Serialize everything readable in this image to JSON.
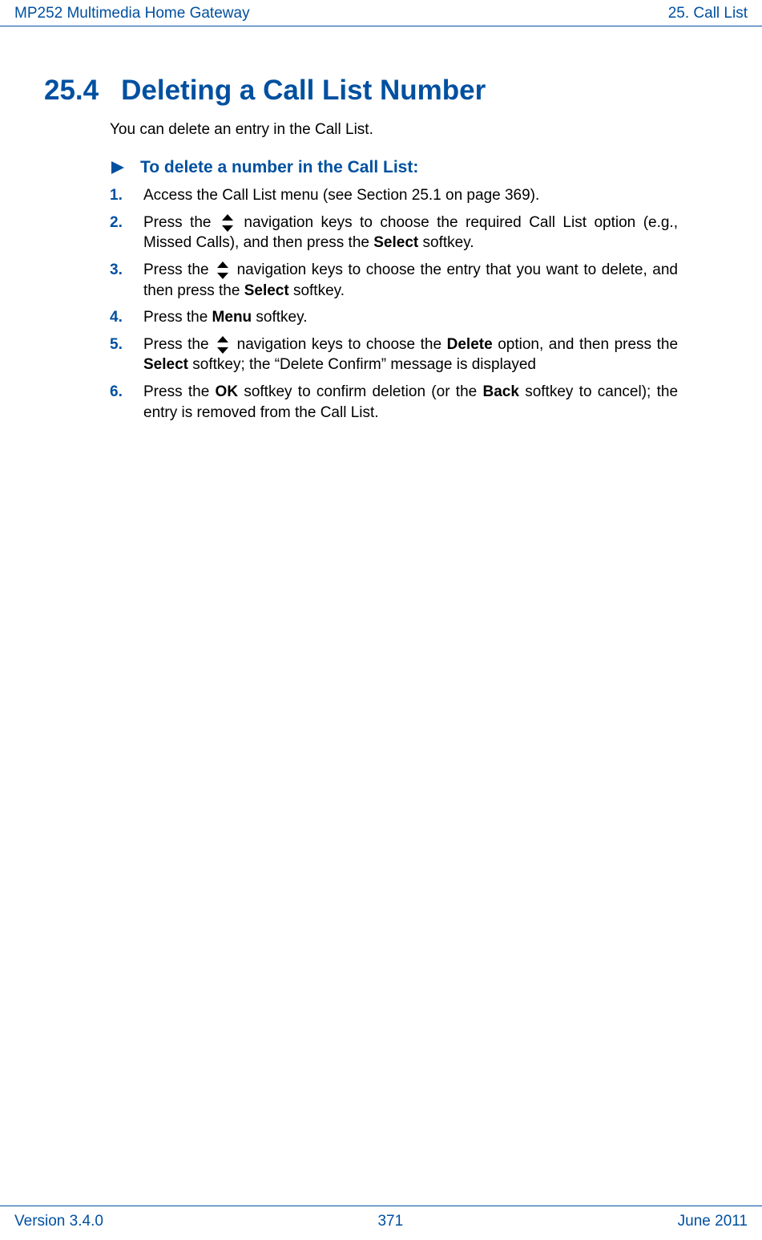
{
  "header": {
    "left": "MP252 Multimedia Home Gateway",
    "right": "25. Call List"
  },
  "section": {
    "number": "25.4",
    "title": "Deleting a Call List Number"
  },
  "intro": "You can delete an entry in the Call List.",
  "procedure_heading": "To delete a number in the Call List:",
  "steps": [
    {
      "n": "1.",
      "pre": "Access the Call List menu (see Section 25.1 on page 369)."
    },
    {
      "n": "2.",
      "pre": "Press the ",
      "post_icon": " navigation keys to choose the required Call List option (e.g., Missed Calls), and then press the ",
      "bold1": "Select",
      "after_bold1": " softkey."
    },
    {
      "n": "3.",
      "pre": "Press the ",
      "post_icon": " navigation keys to choose the entry that you want to delete, and then press the ",
      "bold1": "Select",
      "after_bold1": " softkey."
    },
    {
      "n": "4.",
      "pre": "Press the ",
      "bold1": "Menu",
      "after_bold1": " softkey."
    },
    {
      "n": "5.",
      "pre": "Press the ",
      "post_icon": " navigation keys to choose the ",
      "bold1": "Delete",
      "after_bold1": " option, and then press the ",
      "bold2": "Select",
      "after_bold2": " softkey; the “Delete Confirm” message is displayed"
    },
    {
      "n": "6.",
      "pre": "Press the ",
      "bold1": "OK",
      "after_bold1": " softkey to confirm deletion (or the ",
      "bold2": "Back",
      "after_bold2": " softkey to cancel); the entry is removed from the Call List."
    }
  ],
  "footer": {
    "left": "Version 3.4.0",
    "center": "371",
    "right": "June 2011"
  }
}
